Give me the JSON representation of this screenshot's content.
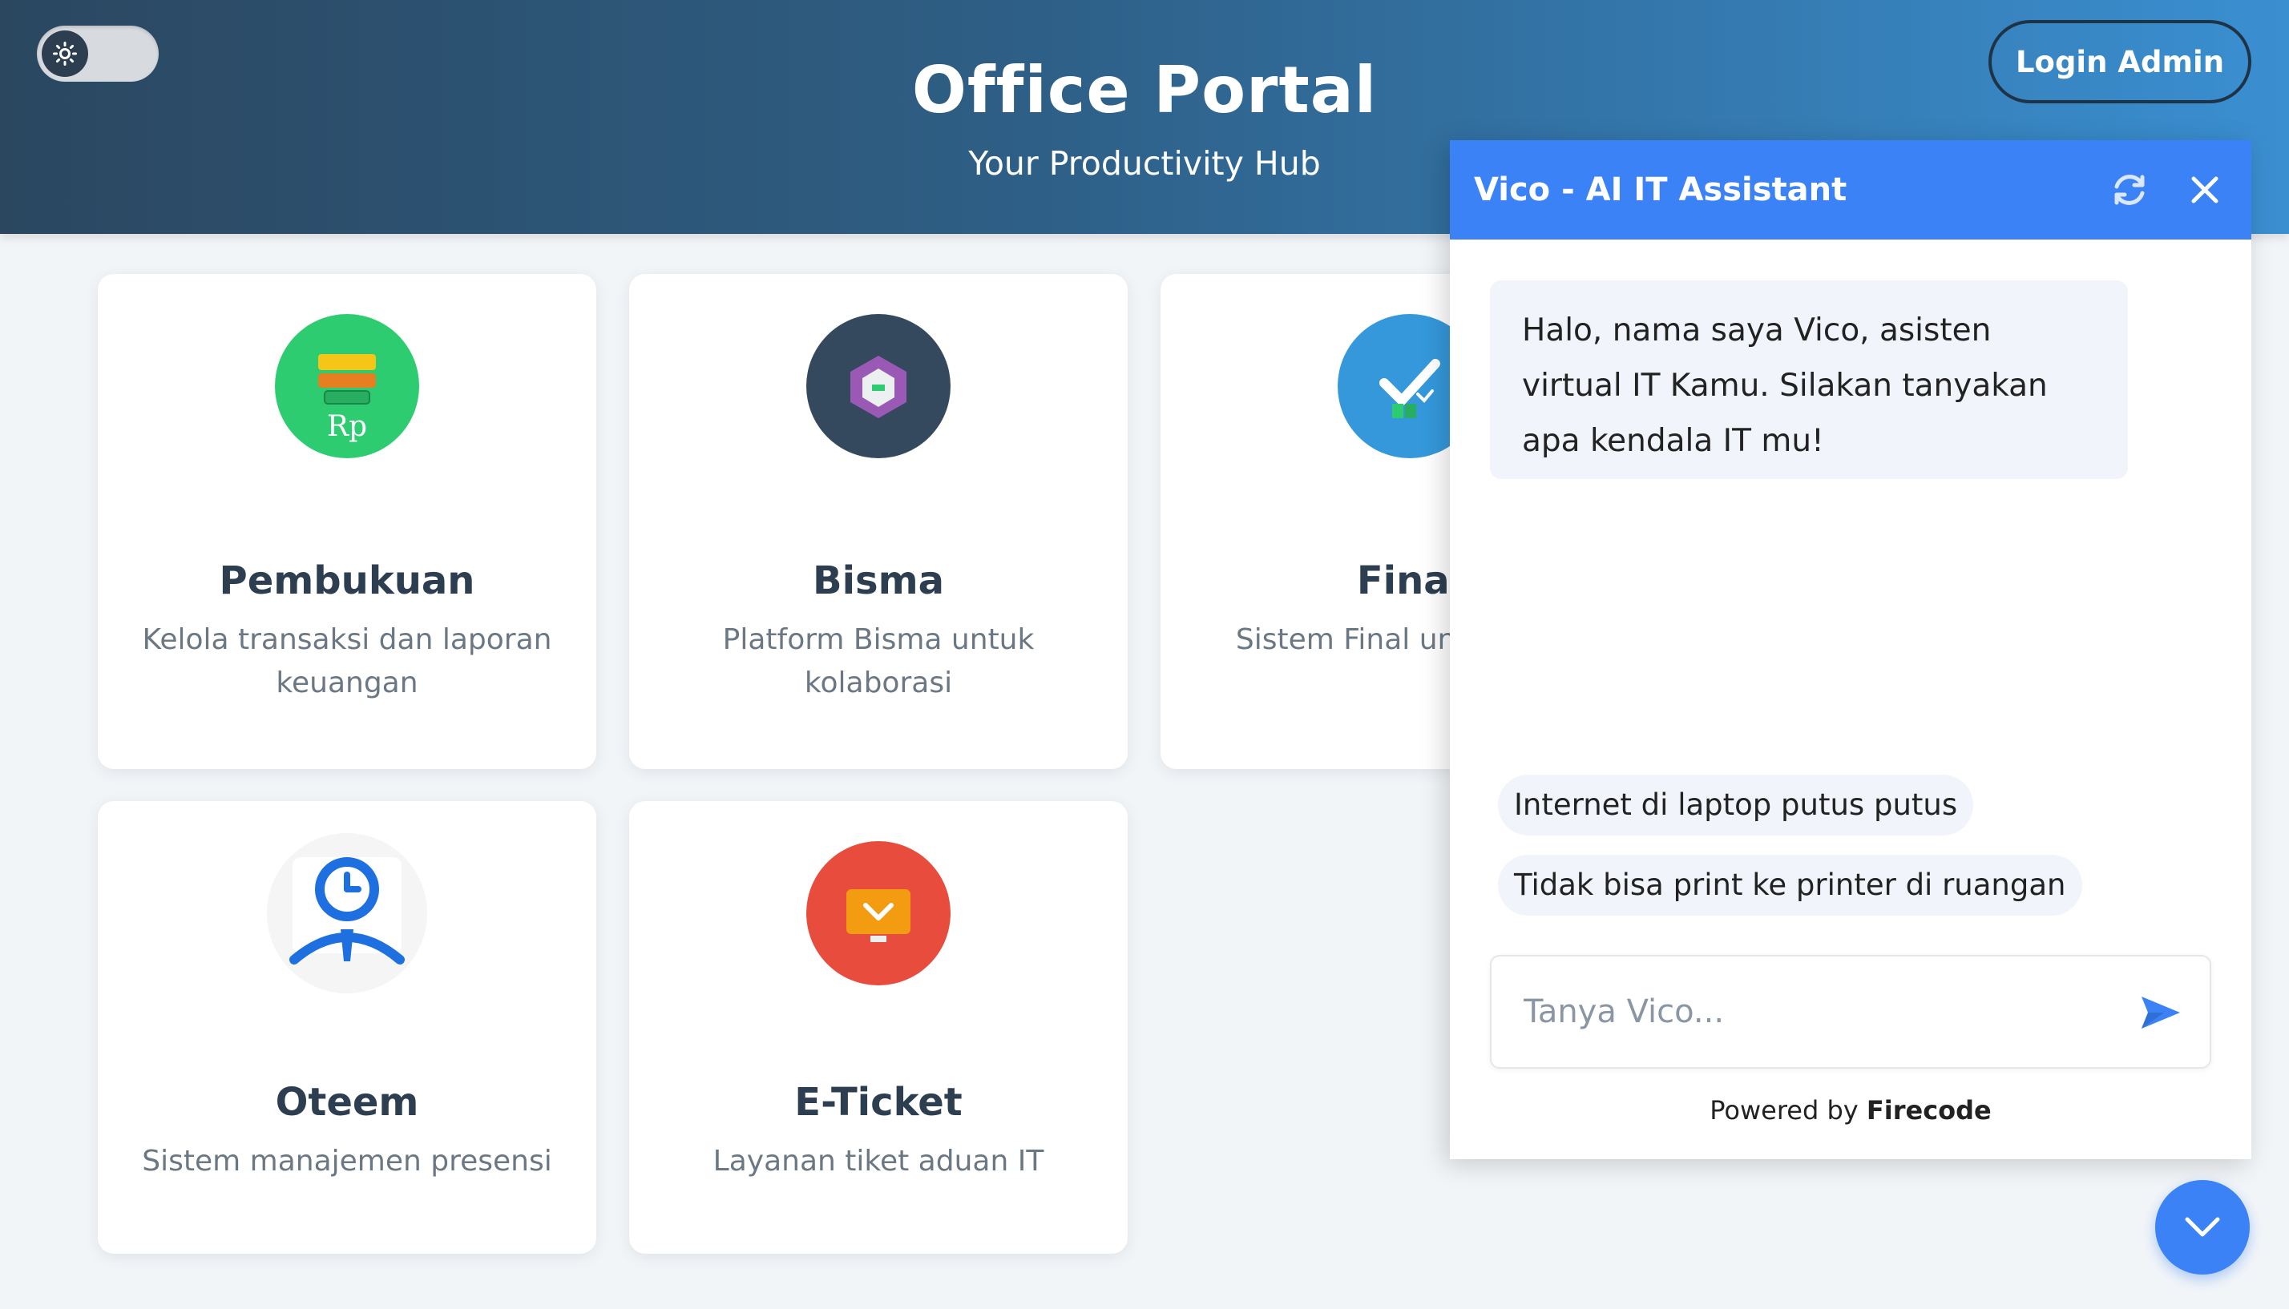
{
  "header": {
    "title": "Office Portal",
    "subtitle": "Your Productivity Hub",
    "login_label": "Login Admin",
    "theme_toggle_icon": "sun-icon"
  },
  "cards": [
    {
      "title": "Pembukuan",
      "desc": "Kelola transaksi dan laporan keuangan",
      "icon": "accounting-icon",
      "icon_label": "Rp",
      "color": "#2ecc71"
    },
    {
      "title": "Bisma",
      "desc": "Platform Bisma untuk kolaborasi",
      "icon": "hexagon-icon",
      "color": "#34495e"
    },
    {
      "title": "Final",
      "desc": "Sistem Final untuk akhir",
      "icon": "checkmark-icon",
      "color": "#3498db"
    },
    {
      "title": "Oteem",
      "desc": "Sistem manajemen presensi",
      "icon": "attendance-icon",
      "color": "#f5f5f5"
    },
    {
      "title": "E-Ticket",
      "desc": "Layanan tiket aduan IT",
      "icon": "ticket-icon",
      "color": "#e74c3c"
    }
  ],
  "chat": {
    "title": "Vico - AI IT Assistant",
    "bot_message": "Halo, nama saya Vico, asisten virtual IT Kamu. Silakan tanyakan apa kendala IT mu!",
    "suggestions": [
      "Internet di laptop putus putus",
      "Tidak bisa print ke printer di ruangan"
    ],
    "input_placeholder": "Tanya Vico...",
    "powered_prefix": "Powered by",
    "powered_brand": "Firecode",
    "accent": "#3b82f6"
  }
}
